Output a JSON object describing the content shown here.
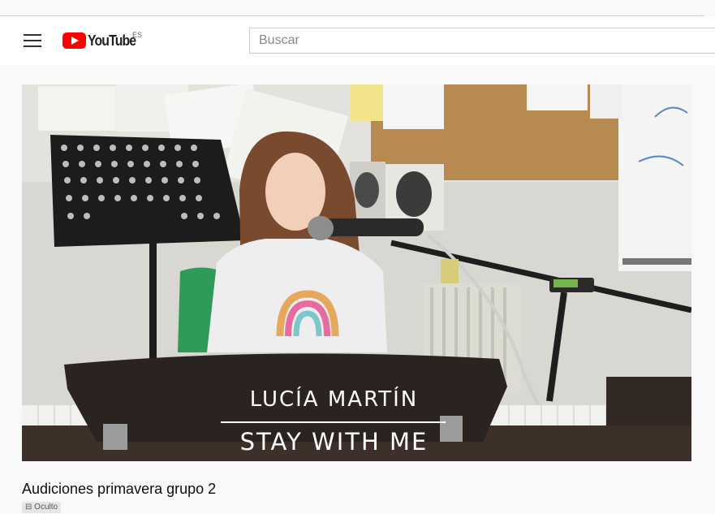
{
  "header": {
    "logo_text": "YouTube",
    "country_code": "ES",
    "search_placeholder": "Buscar"
  },
  "video": {
    "overlay_artist": "LUCÍA MARTÍN",
    "overlay_song": "STAY WITH ME"
  },
  "title": "Audiciones primavera grupo 2",
  "privacy_label": "Oculto",
  "colors": {
    "brand_red": "#ff0000",
    "background": "#f9f9f9"
  }
}
